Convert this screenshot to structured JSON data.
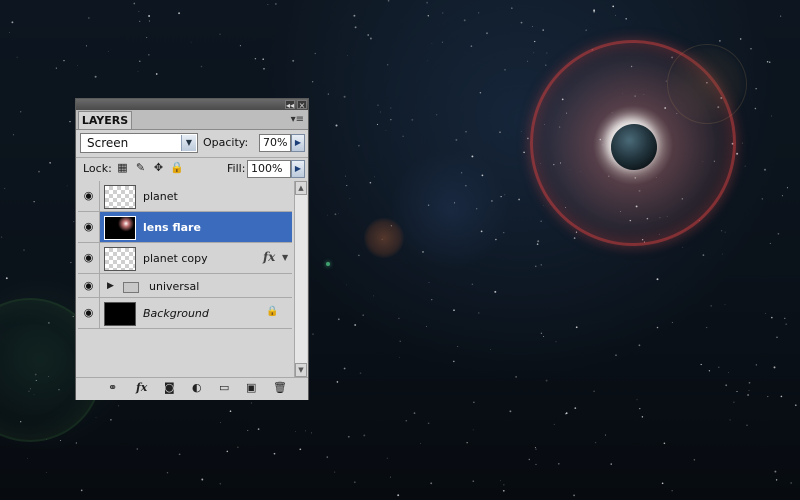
{
  "panel": {
    "tab_title": "LAYERS",
    "collapse_glyph": "◂◂",
    "close_glyph": "×",
    "menu_glyph": "▾≡",
    "blend_mode": "Screen",
    "opacity_label": "Opacity:",
    "opacity_value": "70%",
    "lock_label": "Lock:",
    "fill_label": "Fill:",
    "fill_value": "100%"
  },
  "layers": [
    {
      "name": "planet",
      "selected": false
    },
    {
      "name": "lens flare",
      "selected": true
    },
    {
      "name": "planet  copy",
      "selected": false,
      "fx": "fx"
    },
    {
      "name": "universal",
      "type": "group"
    },
    {
      "name": "Background",
      "locked": true
    }
  ],
  "icons": {
    "eye": "◉",
    "arrow_down": "▼",
    "arrow_right": "▶",
    "lock_transparent": "▦",
    "lock_brush": "✎",
    "lock_move": "✥",
    "lock_all": "🔒",
    "link": "⚭",
    "fx": "fx",
    "mask": "◙",
    "adjust": "◐",
    "folder": "▭",
    "new_layer": "▣",
    "trash": "🗑"
  },
  "colors": {
    "selected_row": "#3a6bbd",
    "panel_bg": "#d4d4d4"
  }
}
